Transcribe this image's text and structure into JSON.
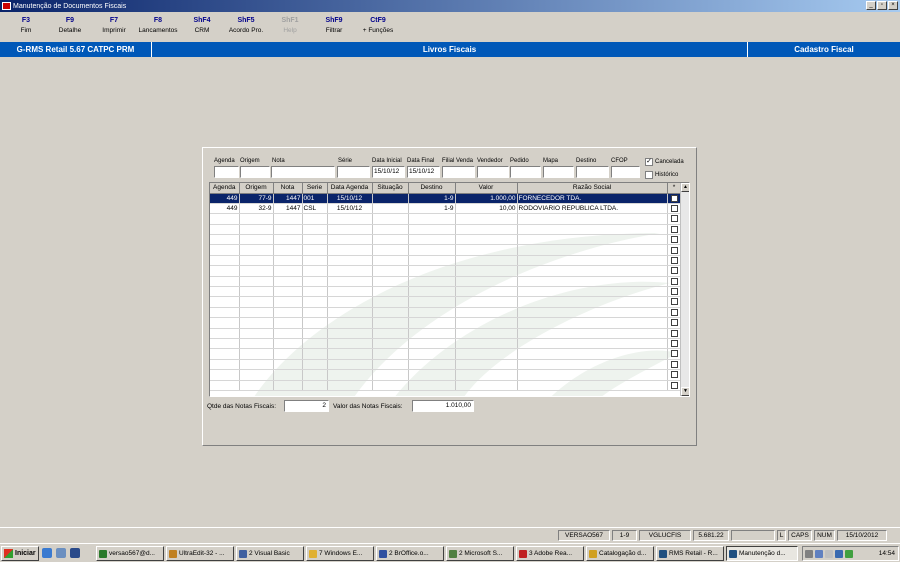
{
  "window": {
    "title": "Manutenção de Documentos Fiscais",
    "btn_min": "_",
    "btn_max": "▫",
    "btn_close": "×"
  },
  "toolbar": [
    {
      "key": "F3",
      "label": "Fim",
      "enabled": true
    },
    {
      "key": "F9",
      "label": "Detalhe",
      "enabled": true
    },
    {
      "key": "F7",
      "label": "Imprimir",
      "enabled": true
    },
    {
      "key": "F8",
      "label": "Lancamentos",
      "enabled": true
    },
    {
      "key": "ShF4",
      "label": "CRM",
      "enabled": true
    },
    {
      "key": "ShF5",
      "label": "Acordo Pro.",
      "enabled": true
    },
    {
      "key": "ShF1",
      "label": "Help",
      "enabled": false
    },
    {
      "key": "ShF9",
      "label": "Filtrar",
      "enabled": true
    },
    {
      "key": "CtF9",
      "label": "+ Funções",
      "enabled": true
    }
  ],
  "header": {
    "left": "G-RMS Retail 5.67 CATPC PRM",
    "center": "Livros Fiscais",
    "right": "Cadastro Fiscal"
  },
  "filters": {
    "agenda": {
      "label": "Agenda",
      "value": ""
    },
    "origem": {
      "label": "Origem",
      "value": ""
    },
    "nota": {
      "label": "Nota",
      "value": ""
    },
    "serie": {
      "label": "Série",
      "value": ""
    },
    "data_inicial": {
      "label": "Data Inicial",
      "value": "15/10/12"
    },
    "data_final": {
      "label": "Data Final",
      "value": "15/10/12"
    },
    "filial_venda": {
      "label": "Filial Venda",
      "value": ""
    },
    "vendedor": {
      "label": "Vendedor",
      "value": ""
    },
    "pedido": {
      "label": "Pedido",
      "value": ""
    },
    "mapa": {
      "label": "Mapa",
      "value": ""
    },
    "destino": {
      "label": "Destino",
      "value": ""
    },
    "cfop": {
      "label": "CFOP",
      "value": ""
    },
    "cancelada": {
      "label": "Cancelada",
      "checked": true
    },
    "historico": {
      "label": "Histórico",
      "checked": false
    }
  },
  "grid": {
    "columns": [
      "Agenda",
      "Origem",
      "Nota",
      "Serie",
      "Data Agenda",
      "Situação",
      "Destino",
      "Valor",
      "Razão Social"
    ],
    "rows": [
      {
        "agenda": "449",
        "origem": "77-9",
        "nota": "1447",
        "serie": "001",
        "data_agenda": "15/10/12",
        "situacao": "",
        "destino": "1-9",
        "valor": "1.000,00",
        "razao_social": "FORNECEDOR TDA.",
        "selected": true
      },
      {
        "agenda": "449",
        "origem": "32-9",
        "nota": "1447",
        "serie": "CSL",
        "data_agenda": "15/10/12",
        "situacao": "",
        "destino": "1-9",
        "valor": "10,00",
        "razao_social": "RODOVIARIO REPUBLICA LTDA.",
        "selected": false
      }
    ],
    "total_visible_rows": 19
  },
  "totals": {
    "qtde_label": "Qtde das Notas Fiscais:",
    "qtde_value": "2",
    "valor_label": "Valor  das Notas Fiscais:",
    "valor_value": "1.010,00"
  },
  "statusbar": [
    "VERSAO567",
    "1-9",
    "VGLUCFIS",
    "5.681.22",
    "",
    "L",
    "CAPS",
    "NUM",
    "15/10/2012"
  ],
  "taskbar": {
    "start": "Iniciar",
    "tasks": [
      {
        "label": "versao567@d...",
        "color": "#2a7a2a"
      },
      {
        "label": "UltraEdit-32 - ...",
        "color": "#c08020"
      },
      {
        "label": "2 Visual Basic",
        "color": "#4060a0"
      },
      {
        "label": "7 Windows E...",
        "color": "#e0b030"
      },
      {
        "label": "2 BrOffice.o...",
        "color": "#3050a0"
      },
      {
        "label": "2 Microsoft S...",
        "color": "#508040"
      },
      {
        "label": "3 Adobe Rea...",
        "color": "#c02020"
      },
      {
        "label": "Catalogação d...",
        "color": "#d0a020"
      },
      {
        "label": "RMS Retail - R...",
        "color": "#205080"
      },
      {
        "label": "Manutenção d...",
        "color": "#205080"
      }
    ],
    "clock": "14:54"
  }
}
